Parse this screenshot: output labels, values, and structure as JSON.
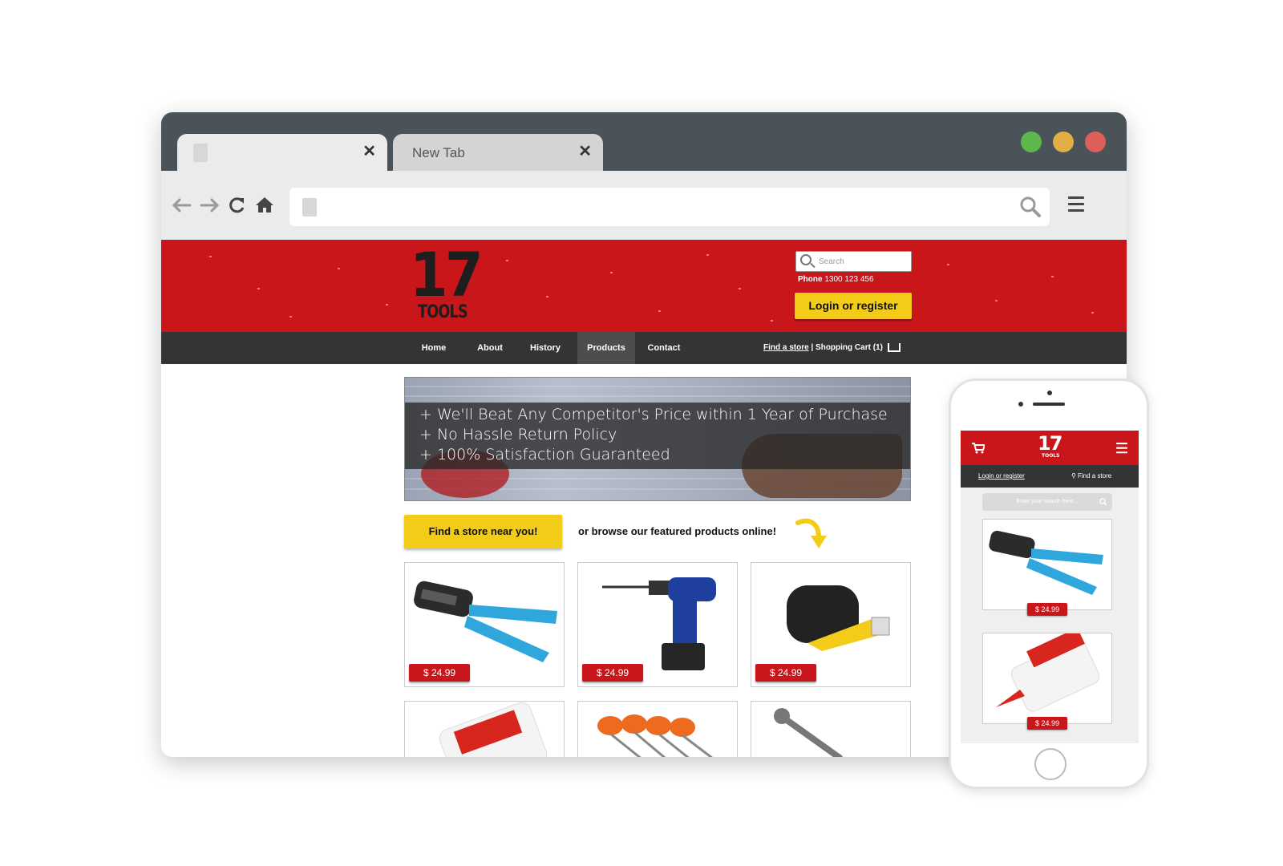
{
  "browser": {
    "tabs": [
      {
        "label": ""
      },
      {
        "label": "New Tab"
      }
    ],
    "tab_close_glyph": "✕",
    "window_buttons": [
      {
        "name": "maximize",
        "color": "#5cb84c"
      },
      {
        "name": "minimize",
        "color": "#e2ae45"
      },
      {
        "name": "close",
        "color": "#dd5f5a"
      }
    ],
    "nav_icons": [
      "back-arrow-icon",
      "forward-arrow-icon",
      "reload-icon",
      "home-icon"
    ],
    "address_value": "",
    "icons": {
      "search": "search-icon",
      "menu": "hamburger-menu-icon"
    }
  },
  "site": {
    "colors": {
      "brand_red": "#c8161b",
      "accent_yellow": "#f2cc18",
      "nav_dark": "#343434"
    },
    "logo": {
      "number": "17",
      "word": "TOOLS"
    },
    "search_placeholder": "Search",
    "phone_label": "Phone",
    "phone_number": "1300 123 456",
    "login_label": "Login or register",
    "nav": [
      {
        "label": "Home"
      },
      {
        "label": "About"
      },
      {
        "label": "History"
      },
      {
        "label": "Products",
        "active": true
      },
      {
        "label": "Contact"
      }
    ],
    "find_a_store_link": "Find a store",
    "cart_text": " | Shopping Cart (1)",
    "banner_lines": [
      "+ We'll Beat Any Competitor's Price within 1 Year of Purchase",
      "+ No Hassle Return Policy",
      "+ 100% Satisfaction Guaranteed"
    ],
    "find_store_button": "Find a store near you!",
    "browse_text": "or browse our featured products online!",
    "products": [
      {
        "name": "crimping-tool",
        "price": "$ 24.99"
      },
      {
        "name": "cordless-drill",
        "price": "$ 24.99"
      },
      {
        "name": "tape-measure",
        "price": "$ 24.99"
      },
      {
        "name": "glue-bottle",
        "price": ""
      },
      {
        "name": "screwdriver-set",
        "price": ""
      },
      {
        "name": "wrench",
        "price": ""
      }
    ]
  },
  "mobile": {
    "login_label": "Login or register",
    "find_store_label": "Find a store",
    "search_placeholder": "Enter your search here...",
    "products": [
      {
        "name": "crimping-tool",
        "price": "$ 24.99"
      },
      {
        "name": "glue-bottle",
        "price": "$ 24.99"
      }
    ]
  }
}
